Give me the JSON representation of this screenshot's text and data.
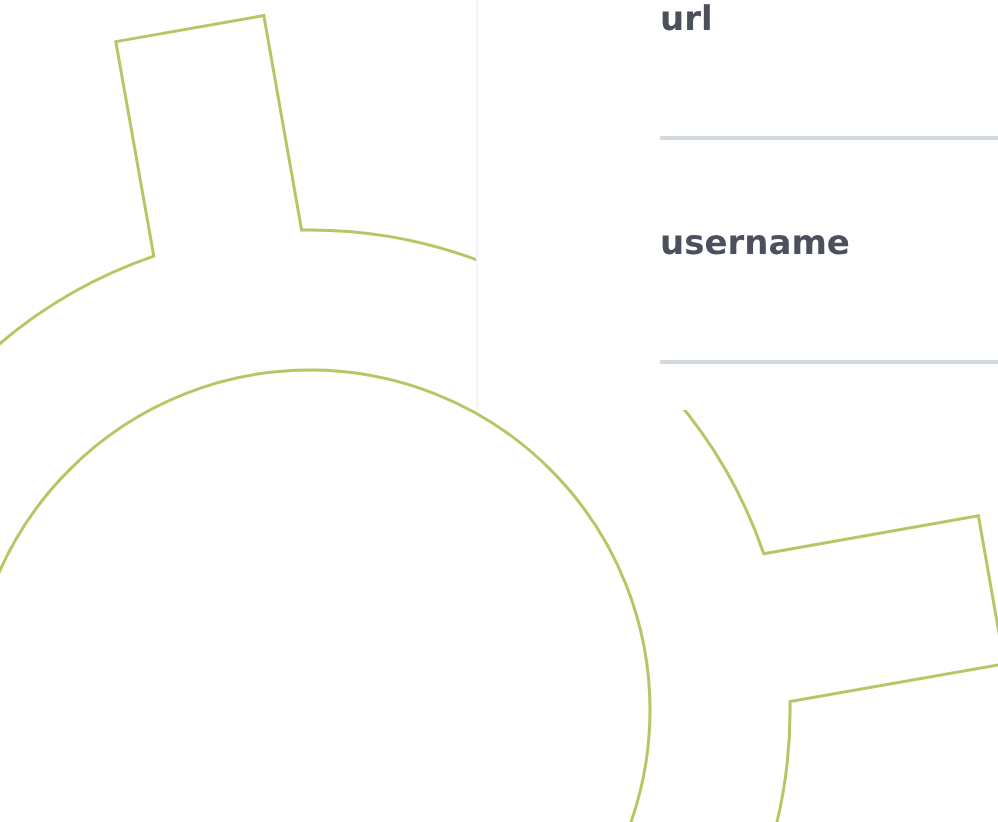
{
  "form": {
    "fields": [
      {
        "label": "url"
      },
      {
        "label": "username"
      }
    ]
  }
}
